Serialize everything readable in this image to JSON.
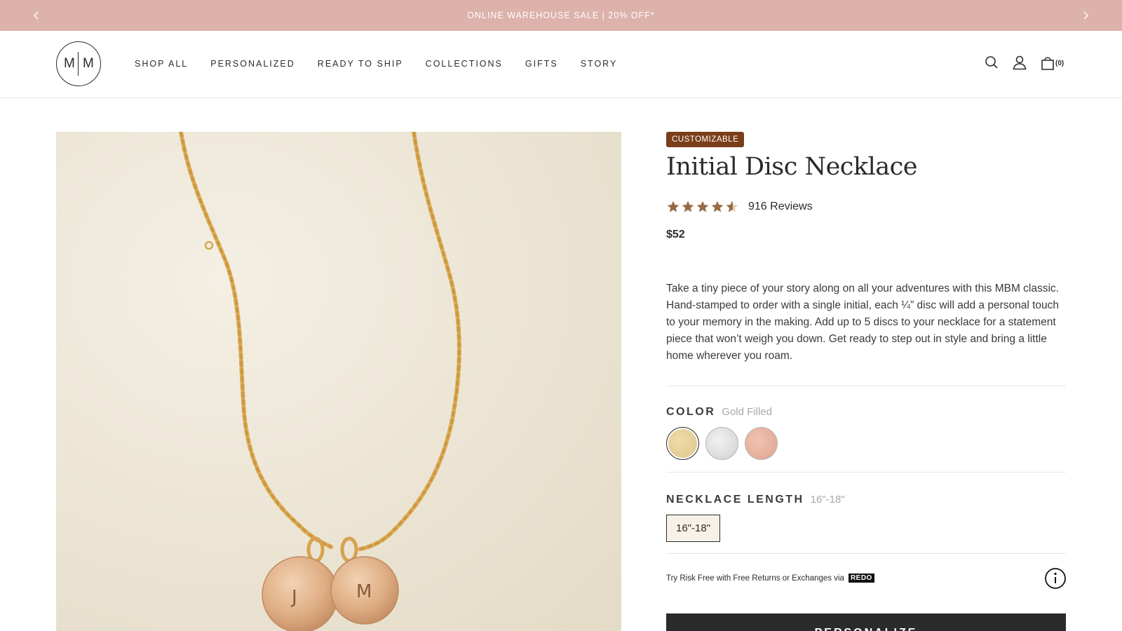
{
  "announcement": {
    "text": "ONLINE WAREHOUSE SALE | 20% OFF*",
    "prev_icon": "chevron-left-icon",
    "next_icon": "chevron-right-icon",
    "background": "#dcb2aa"
  },
  "header": {
    "logo": {
      "left": "M",
      "right": "M"
    },
    "nav": [
      "SHOP ALL",
      "PERSONALIZED",
      "READY TO SHIP",
      "COLLECTIONS",
      "GIFTS",
      "STORY"
    ],
    "icons": [
      "search-icon",
      "account-icon",
      "cart-icon"
    ],
    "cart_count": "(0)"
  },
  "product": {
    "image_label": "gold chain necklace with two discs",
    "disc_letters": [
      "J",
      "M"
    ],
    "badge": "CUSTOMIZABLE",
    "badge_color": "#7a3e1a",
    "title": "Initial Disc Necklace",
    "rating": 4.5,
    "star_color": "#9a6b43",
    "reviews": "916 Reviews",
    "price": "$52",
    "description": "Take a tiny piece of your story along on all your adventures with this MBM classic. Hand-stamped to order with a single initial, each ¼” disc will add a personal touch to your memory in the making. Add up to 5 discs to your necklace for a statement piece that won’t weigh you down. Get ready to step out in style and bring a little home wherever you roam."
  },
  "options": {
    "color": {
      "label": "COLOR",
      "selected": "Gold Filled",
      "swatches": [
        {
          "name": "gold",
          "color": "#e6d19a"
        },
        {
          "name": "silver",
          "color": "#dedede"
        },
        {
          "name": "rose",
          "color": "#e8b3a0"
        }
      ]
    },
    "length": {
      "label": "NECKLACE LENGTH",
      "selected": "16\"-18\"",
      "values": [
        "16\"-18\""
      ]
    }
  },
  "redo": {
    "text": "Try Risk Free with Free Returns or Exchanges via",
    "logo": "REDO",
    "info_icon": "info-icon"
  },
  "cta": {
    "label": "PERSONALIZE"
  }
}
